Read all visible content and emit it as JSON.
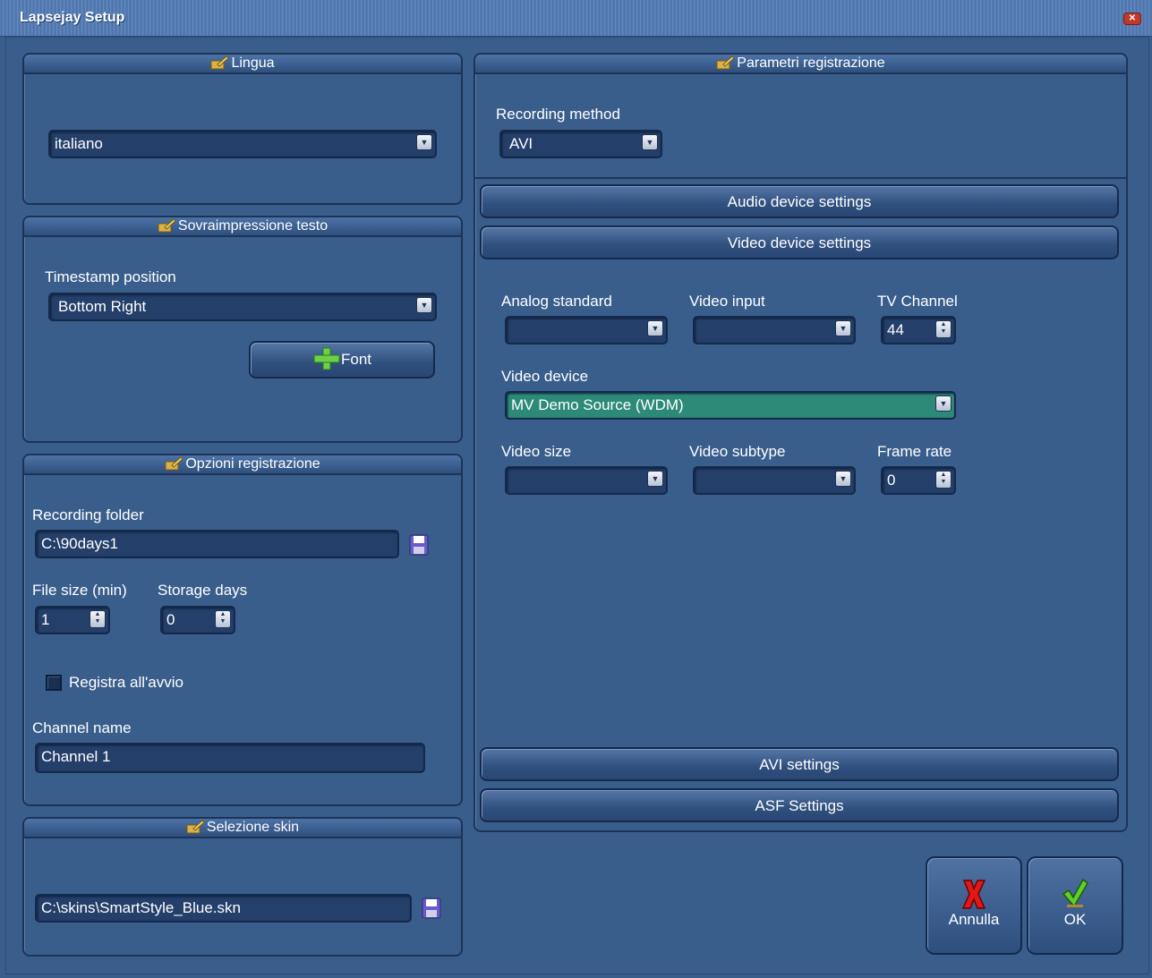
{
  "window": {
    "title": "Lapsejay Setup",
    "close": "✕"
  },
  "lingua": {
    "header": "Lingua",
    "language_value": "italiano"
  },
  "overlay": {
    "header": "Sovraimpressione testo",
    "timestamp_label": "Timestamp position",
    "timestamp_value": "Bottom Right",
    "font_button": "Font"
  },
  "recording_options": {
    "header": "Opzioni registrazione",
    "folder_label": "Recording folder",
    "folder_value": "C:\\90days1",
    "file_size_label": "File size (min)",
    "file_size_value": "1",
    "storage_days_label": "Storage days",
    "storage_days_value": "0",
    "record_on_start_label": "Registra all'avvio",
    "channel_name_label": "Channel name",
    "channel_name_value": "Channel 1"
  },
  "skin": {
    "header": "Selezione skin",
    "skin_value": "C:\\skins\\SmartStyle_Blue.skn"
  },
  "recording_params": {
    "header": "Parametri registrazione",
    "method_label": "Recording method",
    "method_value": "AVI",
    "audio_settings": "Audio device settings",
    "video_settings": "Video device settings",
    "analog_standard_label": "Analog standard",
    "analog_standard_value": "",
    "video_input_label": "Video input",
    "video_input_value": "",
    "tv_channel_label": "TV Channel",
    "tv_channel_value": "44",
    "video_device_label": "Video device",
    "video_device_value": "MV Demo Source (WDM)",
    "video_size_label": "Video size",
    "video_size_value": "",
    "video_subtype_label": "Video subtype",
    "video_subtype_value": "",
    "frame_rate_label": "Frame rate",
    "frame_rate_value": "0",
    "avi_settings": "AVI settings",
    "asf_settings": "ASF Settings"
  },
  "actions": {
    "cancel": "Annulla",
    "ok": "OK"
  },
  "colors": {
    "background": "#3a5e8c",
    "field": "#243f6a",
    "selected_device": "#2e8a78"
  },
  "icons": [
    "pencil-note-icon",
    "dropdown-arrow-icon",
    "spin-arrows-icon",
    "floppy-disk-icon",
    "plus-icon",
    "cancel-x-icon",
    "ok-check-icon"
  ]
}
